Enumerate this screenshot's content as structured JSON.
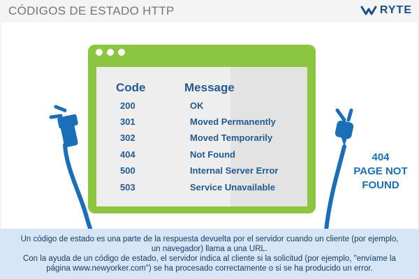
{
  "header": {
    "title": "CÓDIGOS DE ESTADO HTTP",
    "brand": "RYTE"
  },
  "table": {
    "columns": [
      "Code",
      "Message"
    ],
    "rows": [
      {
        "code": "200",
        "message": "OK"
      },
      {
        "code": "301",
        "message": "Moved Permanently"
      },
      {
        "code": "302",
        "message": "Moved Temporarily"
      },
      {
        "code": "404",
        "message": "Not Found"
      },
      {
        "code": "500",
        "message": "Internal Server Error"
      },
      {
        "code": "503",
        "message": "Service Unavailable"
      }
    ]
  },
  "error_message": {
    "code": "404",
    "line1": "PAGE NOT",
    "line2": "FOUND"
  },
  "footer": {
    "p1_line1": "Un código de estado es una parte de la respuesta devuelta por el servidor cuando un cliente (por ejemplo,",
    "p1_line2": "un navegador) llama a una URL.",
    "p2_line1": "Con la ayuda de un código de estado, el servidor indica al cliente si la solicitud (por ejemplo, \"envíame la",
    "p2_line2": "página www.newyorker.com\") se ha procesado correctamente o si se ha producido un error."
  },
  "colors": {
    "window_green": "#8cc640",
    "plug_blue": "#1a6fb6",
    "text_blue": "#245a8f",
    "footer_bg": "#d6e6f6"
  },
  "icons": [
    "ryte-logo-icon",
    "plug-left-icon",
    "plug-right-icon"
  ]
}
